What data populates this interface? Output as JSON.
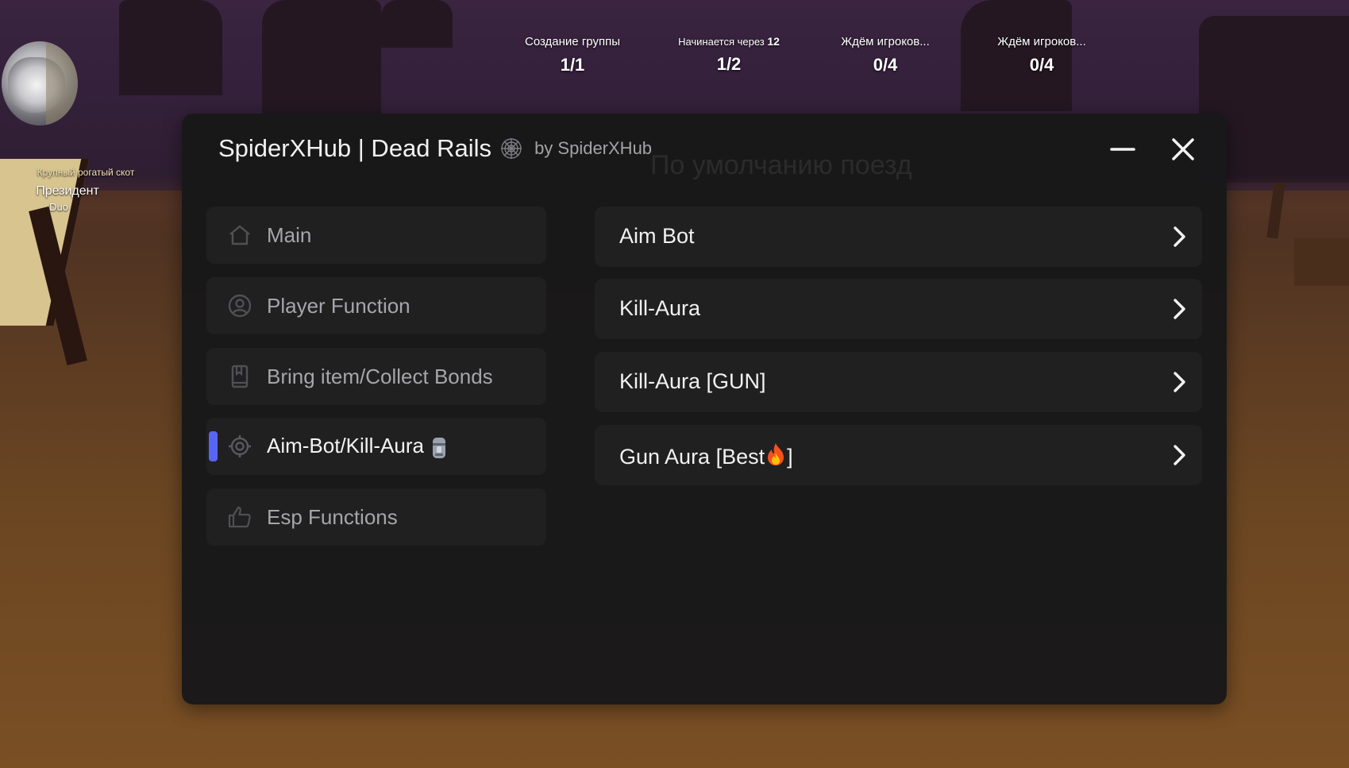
{
  "hud": {
    "player": {
      "title": "Крупный рогатый скот",
      "name": "Президент",
      "team": "Duo"
    },
    "queues": [
      {
        "label": "Создание группы",
        "countdown": "",
        "count": "1/1"
      },
      {
        "label": "Начинается через",
        "countdown": "12",
        "count": "1/2"
      },
      {
        "label": "Ждём игроков...",
        "countdown": "",
        "count": "0/4"
      },
      {
        "label": "Ждём игроков...",
        "countdown": "",
        "count": "0/4"
      }
    ],
    "background_text": "По умолчанию поезд"
  },
  "window": {
    "title": "SpiderXHub | Dead Rails",
    "subtitle": "by SpiderXHub",
    "title_icon": "spider-web-icon",
    "controls": [
      "minimize-icon",
      "close-icon"
    ]
  },
  "sidebar": {
    "accent_color": "#5865f2",
    "items": [
      {
        "label": "Main",
        "icon": "home-icon",
        "active": false
      },
      {
        "label": "Player Function",
        "icon": "user-circle-icon",
        "active": false
      },
      {
        "label": "Bring item/Collect Bonds",
        "icon": "bookmark-icon",
        "active": false
      },
      {
        "label": "Aim-Bot/Kill-Aura",
        "icon": "target-icon",
        "badge_icon": "moai-icon",
        "active": true
      },
      {
        "label": "Esp Functions",
        "icon": "thumbs-up-icon",
        "active": false
      }
    ]
  },
  "functions": {
    "items": [
      {
        "label": "Aim Bot",
        "icon": "chevron-right-icon"
      },
      {
        "label": "Kill-Aura",
        "icon": "chevron-right-icon"
      },
      {
        "label": "Kill-Aura [GUN]",
        "icon": "chevron-right-icon"
      },
      {
        "label": "Gun Aura [Best",
        "suffix": "]",
        "emoji": "fire-icon",
        "icon": "chevron-right-icon"
      }
    ]
  }
}
